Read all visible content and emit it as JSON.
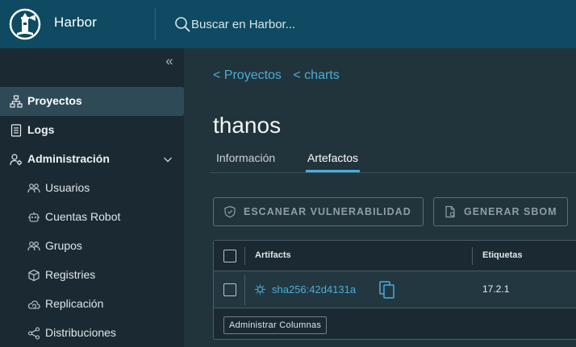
{
  "header": {
    "app_name": "Harbor",
    "search_placeholder": "Buscar en Harbor..."
  },
  "sidebar": {
    "items": [
      {
        "label": "Proyectos",
        "icon": "projects-icon",
        "active": true
      },
      {
        "label": "Logs",
        "icon": "logs-icon"
      },
      {
        "label": "Administración",
        "icon": "admin-icon",
        "expanded": true
      }
    ],
    "admin_items": [
      {
        "label": "Usuarios",
        "icon": "users-icon"
      },
      {
        "label": "Cuentas Robot",
        "icon": "robot-icon"
      },
      {
        "label": "Grupos",
        "icon": "groups-icon"
      },
      {
        "label": "Registries",
        "icon": "registries-icon"
      },
      {
        "label": "Replicación",
        "icon": "replication-icon"
      },
      {
        "label": "Distribuciones",
        "icon": "distributions-icon"
      }
    ]
  },
  "breadcrumb": [
    "< Proyectos",
    "< charts"
  ],
  "page_title": "thanos",
  "tabs": [
    {
      "label": "Información",
      "active": false
    },
    {
      "label": "Artefactos",
      "active": true
    }
  ],
  "actions": {
    "scan": "ESCANEAR VULNERABILIDAD",
    "sbom": "GENERAR SBOM"
  },
  "table": {
    "columns": [
      "Artifacts",
      "Etiquetas"
    ],
    "rows": [
      {
        "artifact": "sha256:42d4131a",
        "tags": "17.2.1",
        "type_icon": "helm-chart-icon"
      }
    ],
    "footer_button": "Administrar Columnas"
  },
  "colors": {
    "header_bg": "#0e4a62",
    "sidebar_bg": "#1b2a32",
    "main_bg": "#21333b",
    "accent": "#49afd9",
    "active_nav": "#2f4a57"
  }
}
